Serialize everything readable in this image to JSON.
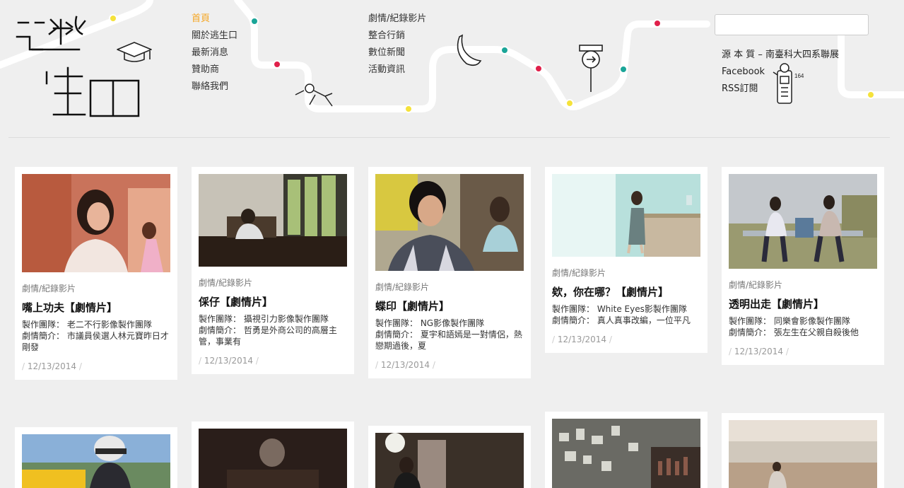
{
  "brand": {
    "accent": "#f5a623",
    "dot_red": "#e0204a",
    "dot_teal": "#1aa598",
    "dot_yellow": "#f5e23a"
  },
  "nav_main": [
    {
      "label": "首頁",
      "active": true
    },
    {
      "label": "關於逃生口",
      "active": false
    },
    {
      "label": "最新消息",
      "active": false
    },
    {
      "label": "贊助商",
      "active": false
    },
    {
      "label": "聯絡我們",
      "active": false
    }
  ],
  "nav_categories": [
    {
      "label": "劇情/紀錄影片"
    },
    {
      "label": "整合行銷"
    },
    {
      "label": "數位新聞"
    },
    {
      "label": "活動資訊"
    }
  ],
  "search": {
    "value": "",
    "placeholder": ""
  },
  "side_links": [
    {
      "label": "源 本 質 – 南臺科大四系聯展"
    },
    {
      "label": "Facebook"
    },
    {
      "label": "RSS訂閱"
    }
  ],
  "posts": [
    {
      "category": "劇情/紀錄影片",
      "title": "嘴上功夫【劇情片】",
      "team": "製作團隊： 老二不行影像製作團隊",
      "synopsis": "劇情簡介： 市議員侯選人林元寶昨日才剛發",
      "date": "12/13/2014",
      "image": "photo-girl-school-uniform"
    },
    {
      "category": "劇情/紀錄影片",
      "title": "倸仔【劇情片】",
      "team": "製作團隊： 攝視引力影像製作團隊",
      "synopsis": "劇情簡介： 哲勇是外商公司的高層主管，事業有",
      "date": "12/13/2014",
      "image": "photo-office-desk"
    },
    {
      "category": "劇情/紀錄影片",
      "title": "蝶印【劇情片】",
      "team": "製作團隊： NG影像製作團隊",
      "synopsis": "劇情簡介： 夏宇和語嫣是一對情侶，熱戀期過後，夏",
      "date": "12/13/2014",
      "image": "photo-couple-cafe"
    },
    {
      "category": "劇情/紀錄影片",
      "title": "欸，你在哪？【劇情片】",
      "team": "製作團隊： White Eyes影製作團隊",
      "synopsis": "劇情簡介： 真人真事改編，一位平凡",
      "date": "12/13/2014",
      "image": "photo-girl-corridor"
    },
    {
      "category": "劇情/紀錄影片",
      "title": "透明出走【劇情片】",
      "team": "製作團隊： 同樂會影像製作團隊",
      "synopsis": "劇情簡介： 張左生在父親自殺後他",
      "date": "12/13/2014",
      "image": "photo-two-men-bench"
    }
  ],
  "posts_row2": [
    {
      "image": "photo-scooter-helmet"
    },
    {
      "image": "photo-dark-room-lamp"
    },
    {
      "image": "photo-man-lamp"
    },
    {
      "image": "photo-photo-wall-bar"
    },
    {
      "image": "photo-beach-sitting"
    }
  ]
}
